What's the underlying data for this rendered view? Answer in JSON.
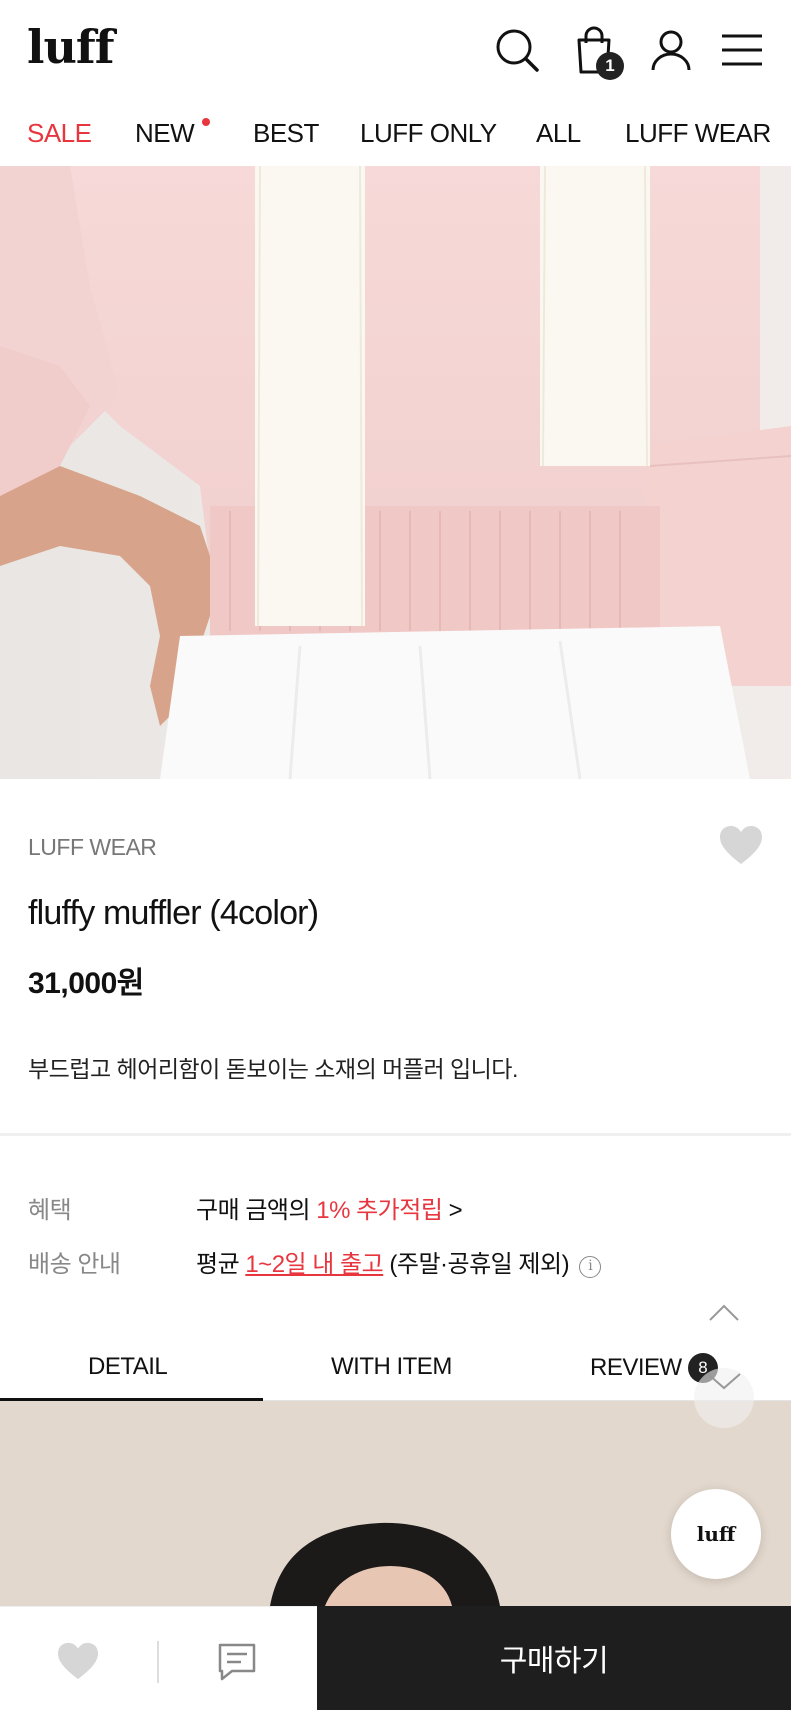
{
  "header": {
    "logo": "luff",
    "cart_count": "1"
  },
  "nav": {
    "items": [
      {
        "label": "SALE"
      },
      {
        "label": "NEW"
      },
      {
        "label": "BEST"
      },
      {
        "label": "LUFF ONLY"
      },
      {
        "label": "ALL"
      },
      {
        "label": "LUFF WEAR"
      }
    ]
  },
  "product": {
    "brand": "LUFF WEAR",
    "name": "fluffy muffler (4color)",
    "price": "31,000원",
    "description": "부드럽고 헤어리함이 돋보이는 소재의 머플러 입니다."
  },
  "info": {
    "benefit_label": "혜택",
    "benefit_prefix": "구매 금액의 ",
    "benefit_highlight": "1% 추가적립",
    "benefit_suffix": " >",
    "shipping_label": "배송 안내",
    "shipping_prefix": "평균 ",
    "shipping_highlight": "1~2일 내 출고",
    "shipping_suffix": " (주말·공휴일 제외)",
    "info_glyph": "i"
  },
  "tabs": {
    "items": [
      {
        "label": "DETAIL"
      },
      {
        "label": "WITH ITEM"
      },
      {
        "label": "REVIEW"
      }
    ],
    "review_count": "8"
  },
  "floating": {
    "logo": "luff"
  },
  "bottom_bar": {
    "buy_label": "구매하기"
  },
  "colors": {
    "accent_red": "#e8363f",
    "buy_bg": "#1e1e1e"
  }
}
